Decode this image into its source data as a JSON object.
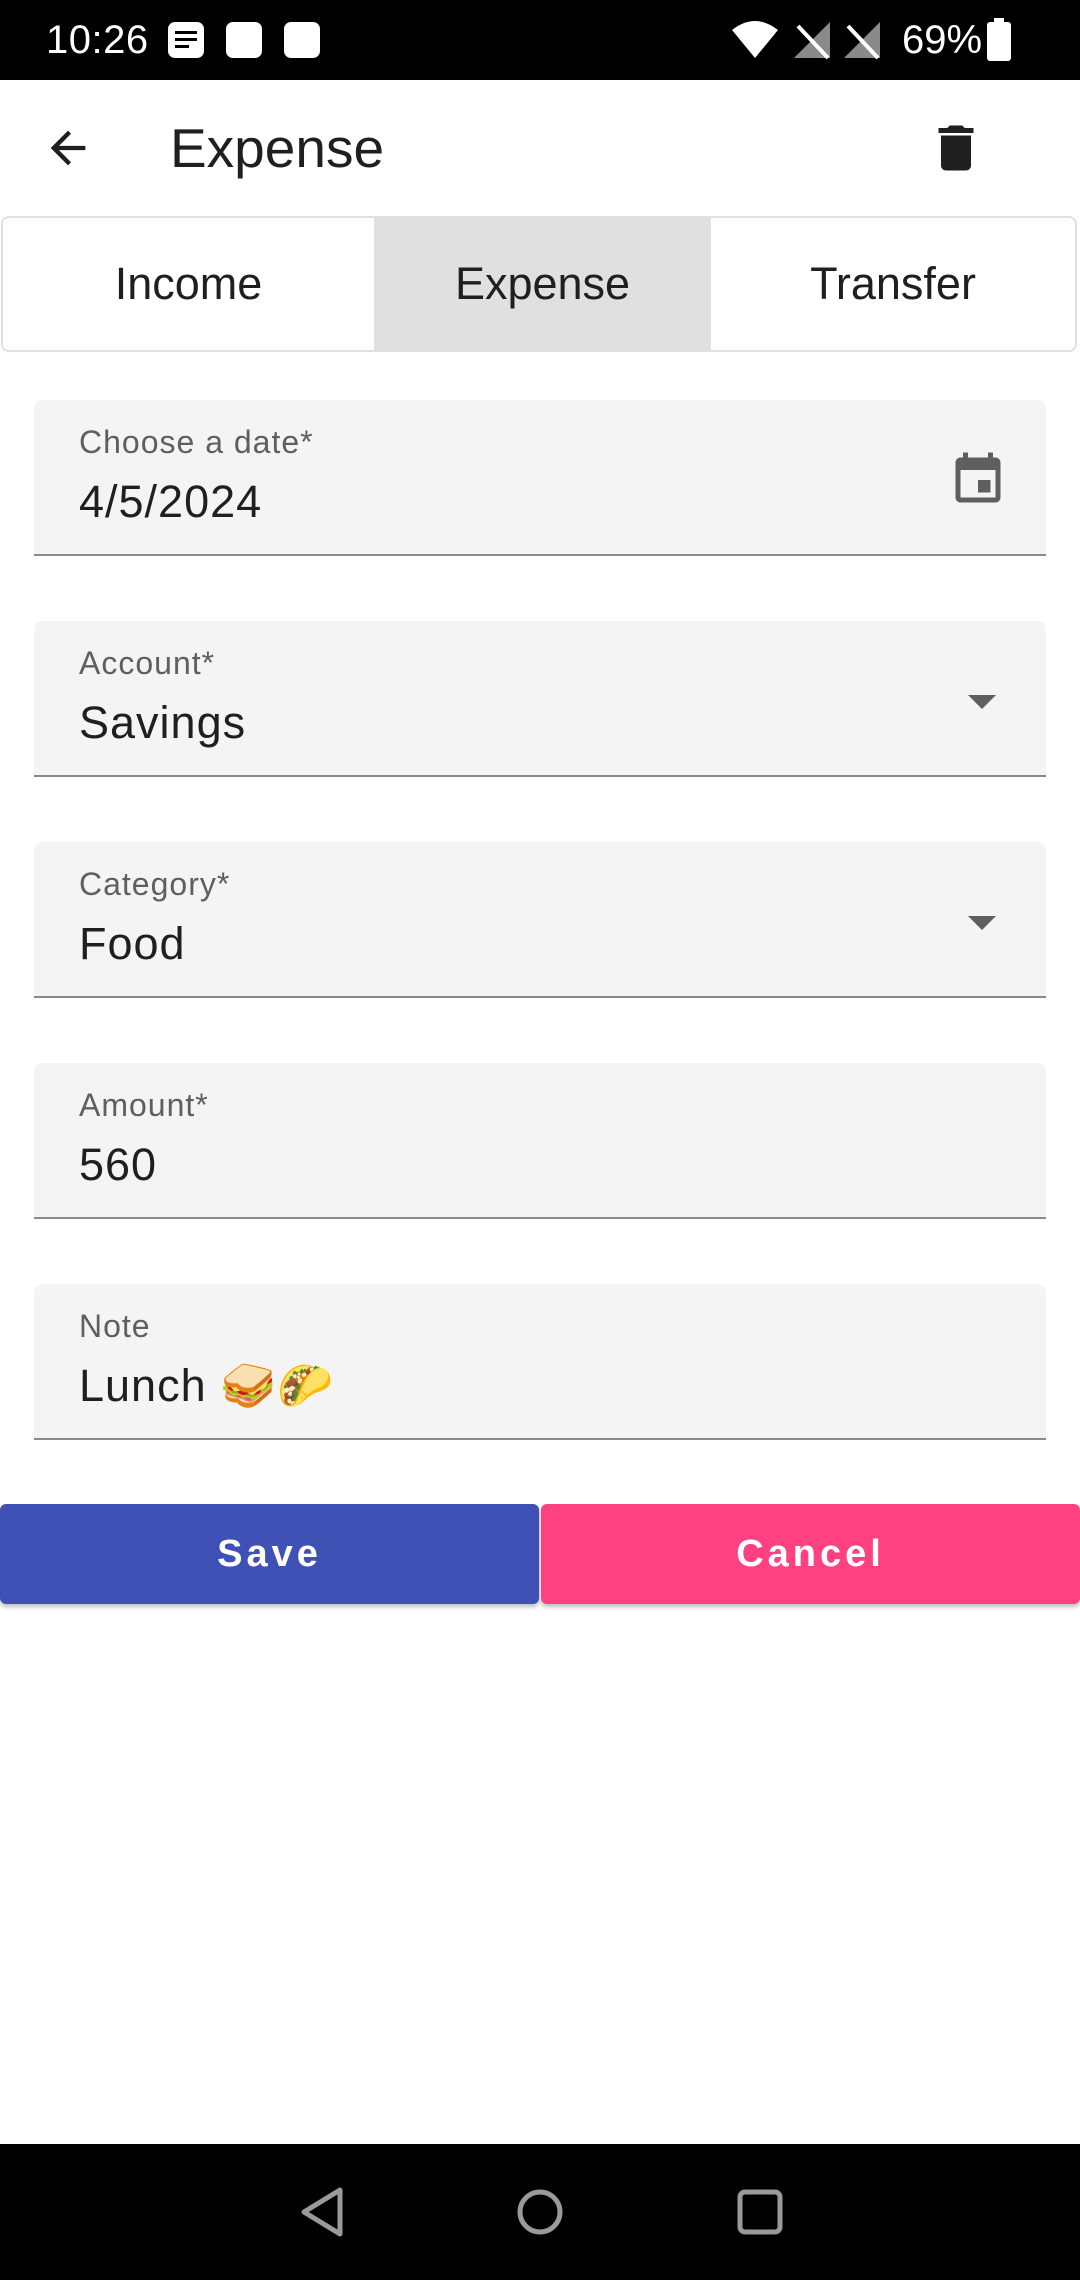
{
  "status_bar": {
    "time": "10:26",
    "battery": "69%",
    "icons": [
      "notes-icon",
      "square-notification-icon",
      "square-notification-icon",
      "wifi-icon",
      "no-signal-icon",
      "no-signal-icon",
      "battery-icon"
    ]
  },
  "app_bar": {
    "title": "Expense",
    "back_icon": "arrow-left-icon",
    "delete_icon": "trash-icon"
  },
  "tabs": [
    {
      "label": "Income",
      "selected": false
    },
    {
      "label": "Expense",
      "selected": true
    },
    {
      "label": "Transfer",
      "selected": false
    }
  ],
  "form": {
    "date": {
      "label": "Choose a date*",
      "value": "4/5/2024",
      "icon": "calendar-icon"
    },
    "account": {
      "label": "Account*",
      "value": "Savings",
      "icon": "dropdown-arrow-icon"
    },
    "category": {
      "label": "Category*",
      "value": "Food",
      "icon": "dropdown-arrow-icon"
    },
    "amount": {
      "label": "Amount*",
      "value": "560"
    },
    "note": {
      "label": "Note",
      "value": "Lunch 🥪🌮"
    }
  },
  "actions": {
    "save": "Save",
    "cancel": "Cancel"
  },
  "colors": {
    "save": "#3f51b5",
    "cancel": "#ff4081",
    "selected_tab": "#e0e0e0",
    "field_bg": "#f4f4f4"
  }
}
